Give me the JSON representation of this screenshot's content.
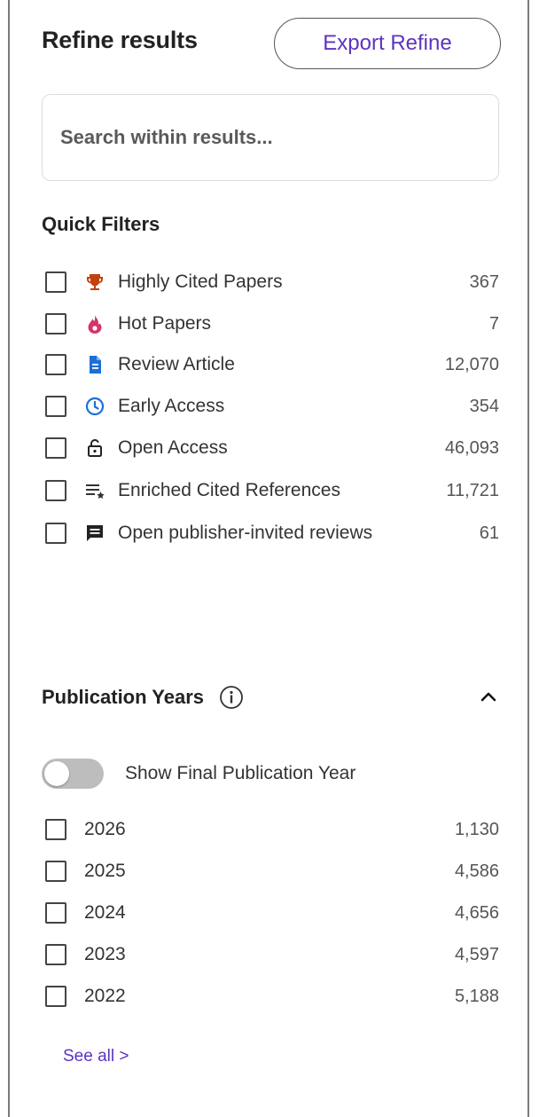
{
  "header": {
    "title": "Refine results",
    "export_label": "Export Refine"
  },
  "search": {
    "placeholder": "Search within results..."
  },
  "quick_filters": {
    "title": "Quick Filters",
    "items": [
      {
        "label": "Highly Cited Papers",
        "count": "367",
        "icon": "trophy-icon",
        "icon_color": "#c2410c"
      },
      {
        "label": "Hot Papers",
        "count": "7",
        "icon": "flame-icon",
        "icon_color": "#d6336c"
      },
      {
        "label": "Review Article",
        "count": "12,070",
        "icon": "document-icon",
        "icon_color": "#1d6fd6"
      },
      {
        "label": "Early Access",
        "count": "354",
        "icon": "clock-icon",
        "icon_color": "#1d6fd6"
      },
      {
        "label": "Open Access",
        "count": "46,093",
        "icon": "open-lock-icon",
        "icon_color": "#222222"
      },
      {
        "label": "Enriched Cited References",
        "count": "11,721",
        "icon": "list-star-icon",
        "icon_color": "#333333"
      },
      {
        "label": "Open publisher-invited reviews",
        "count": "61",
        "icon": "comment-icon",
        "icon_color": "#222222"
      }
    ]
  },
  "publication_years": {
    "title": "Publication Years",
    "toggle_label": "Show Final Publication Year",
    "items": [
      {
        "label": "2026",
        "count": "1,130"
      },
      {
        "label": "2025",
        "count": "4,586"
      },
      {
        "label": "2024",
        "count": "4,656"
      },
      {
        "label": "2023",
        "count": "4,597"
      },
      {
        "label": "2022",
        "count": "5,188"
      }
    ],
    "see_all": "See all >"
  },
  "colors": {
    "accent": "#5e33bf",
    "toggle_off": "#bdbdbd"
  }
}
